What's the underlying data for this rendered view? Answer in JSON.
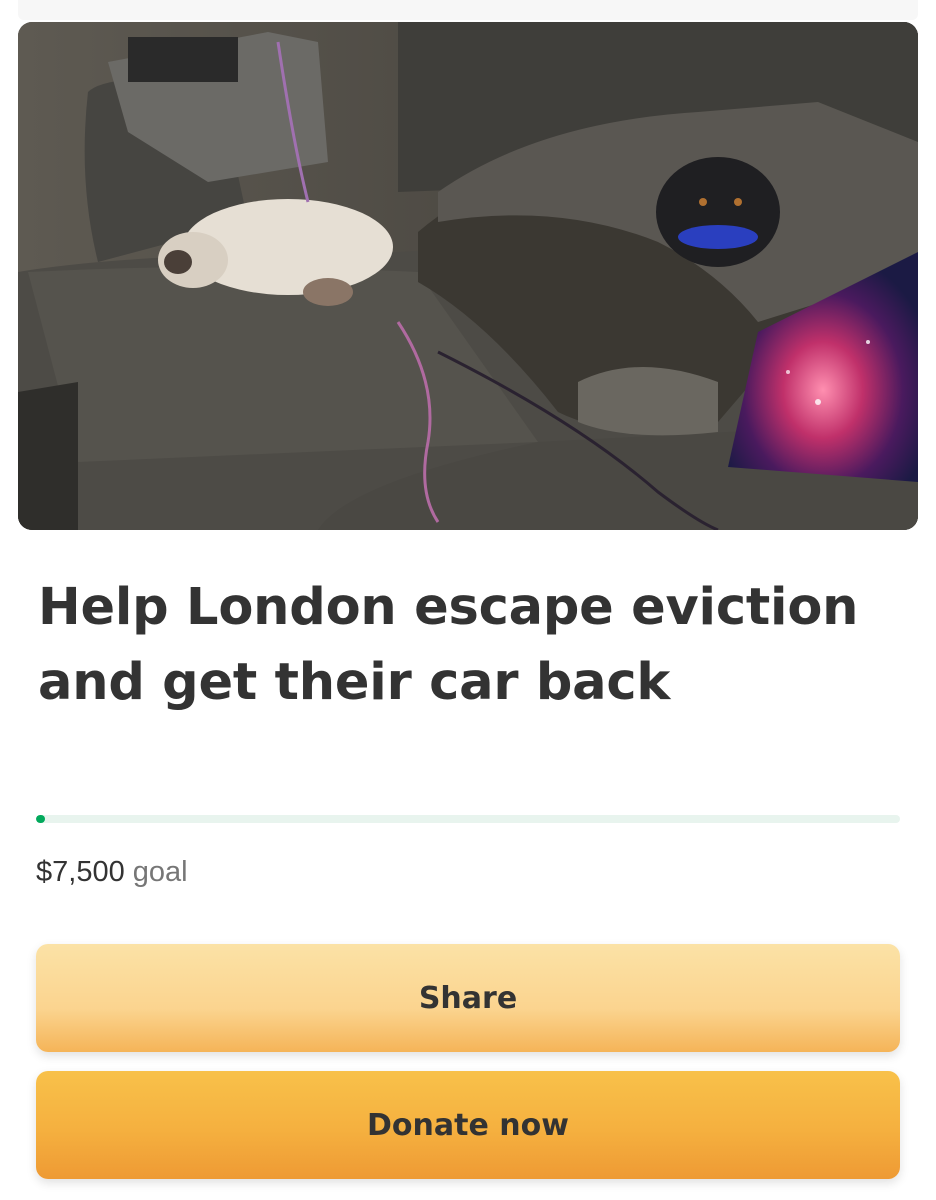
{
  "campaign": {
    "title": "Help London escape eviction and get their car back",
    "goal_amount": "$7,500",
    "goal_label": "goal",
    "progress_fraction": 0.01
  },
  "hero": {
    "description_icon": "campaign-photo"
  },
  "actions": {
    "share_label": "Share",
    "donate_label": "Donate now"
  },
  "colors": {
    "progress": "#02a95c",
    "share_button": "#fbd48f",
    "donate_button": "#f5b03f",
    "text": "#333333"
  }
}
